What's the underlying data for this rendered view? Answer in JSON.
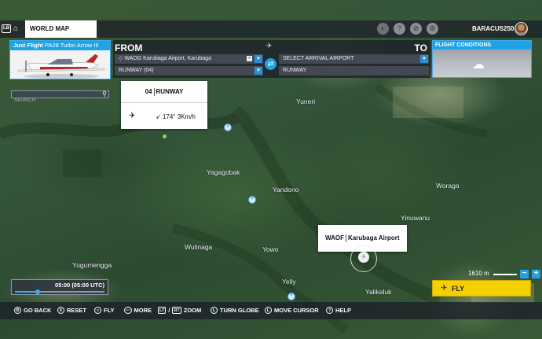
{
  "topbar": {
    "lb_key": "LB",
    "tab_title": "WORLD MAP",
    "username": "BARACUS250",
    "icons": [
      "globe-icon",
      "help-icon",
      "cancel-icon",
      "gear-icon"
    ]
  },
  "aircraft": {
    "brand": "Just Flight",
    "model": "PA28 Turbo Arrow III"
  },
  "route": {
    "from_label": "FROM",
    "to_label": "TO",
    "departure": "WAOG Karubaga Airport, Karubaga",
    "departure_badge": "★",
    "departure_runway": "RUNWAY (04)",
    "arrival": "SELECT ARRIVAL AIRPORT",
    "arrival_runway": "RUNWAY"
  },
  "flight_conditions": {
    "title": "FLIGHT CONDITIONS",
    "icon": "cloud-icon"
  },
  "search": {
    "placeholder": "SEARCH"
  },
  "runway_card": {
    "runway_number": "04",
    "runway_label": "RUNWAY",
    "wind": "174° 3Km/h"
  },
  "airport_label": {
    "icao": "WAOF",
    "name": "Karubaga Airport"
  },
  "places": [
    {
      "name": "Yuneri"
    },
    {
      "name": "Yagagobak"
    },
    {
      "name": "Yandono"
    },
    {
      "name": "Woraga"
    },
    {
      "name": "Yinuwanu"
    },
    {
      "name": "Wulinaga"
    },
    {
      "name": "Yowo"
    },
    {
      "name": "Yugumengga"
    },
    {
      "name": "Yelly"
    },
    {
      "name": "Yalikaluk"
    }
  ],
  "time": {
    "display": "05:00 (05:00 UTC)",
    "slider_fraction": 0.25
  },
  "scale": {
    "label": "1610 m"
  },
  "fly_button": {
    "label": "FLY"
  },
  "hints": [
    {
      "key": "B",
      "label": "GO BACK"
    },
    {
      "key": "X",
      "label": "RESET"
    },
    {
      "key": "≡",
      "label": "FLY"
    },
    {
      "key": "⋯",
      "label": "MORE"
    },
    {
      "key": "LT",
      "key2": "RT",
      "label": "ZOOM"
    },
    {
      "key": "L",
      "label": "TURN GLOBE"
    },
    {
      "key": "L",
      "label": "MOVE CURSOR"
    },
    {
      "key": "?",
      "label": "HELP"
    }
  ],
  "colors": {
    "accent": "#1fa3e6",
    "fly": "#f5d000"
  }
}
